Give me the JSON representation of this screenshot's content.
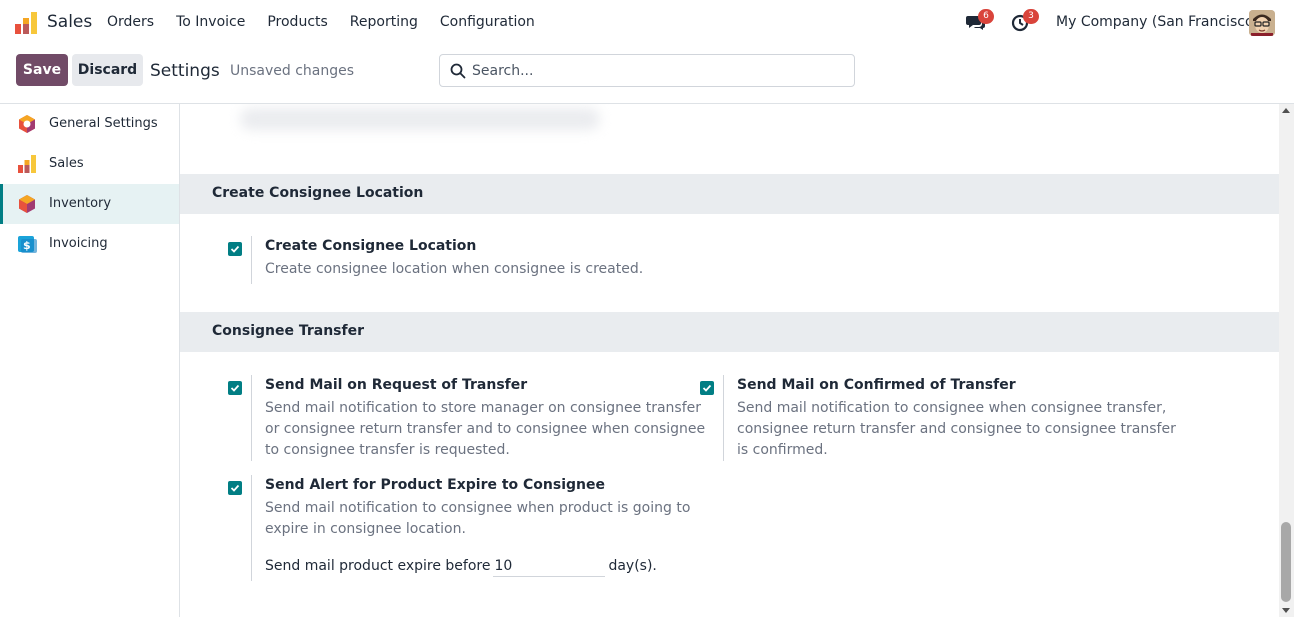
{
  "navbar": {
    "app_name": "Sales",
    "menu": [
      "Orders",
      "To Invoice",
      "Products",
      "Reporting",
      "Configuration"
    ],
    "messages_badge": "6",
    "activities_badge": "3",
    "company": "My Company (San Francisco)"
  },
  "control": {
    "save_label": "Save",
    "discard_label": "Discard",
    "breadcrumb": "Settings",
    "status": "Unsaved changes",
    "search_placeholder": "Search..."
  },
  "sidebar": {
    "items": [
      {
        "label": "General Settings",
        "icon": "general-settings-icon"
      },
      {
        "label": "Sales",
        "icon": "sales-app-icon"
      },
      {
        "label": "Inventory",
        "icon": "inventory-app-icon",
        "active": true
      },
      {
        "label": "Invoicing",
        "icon": "invoicing-app-icon"
      }
    ]
  },
  "sections": {
    "consignee_location": {
      "title": "Create Consignee Location",
      "setting": {
        "title": "Create Consignee Location",
        "desc": "Create consignee location when consignee is created.",
        "checked": true
      }
    },
    "consignee_transfer": {
      "title": "Consignee Transfer",
      "request_mail": {
        "title": "Send Mail on Request of Transfer",
        "desc_lines": [
          "Send mail notification to store manager on consignee transfer",
          "or consignee return transfer and to consignee when consignee",
          "to consignee transfer is requested."
        ],
        "checked": true
      },
      "confirmed_mail": {
        "title": "Send Mail on Confirmed of Transfer",
        "desc_lines": [
          "Send mail notification to consignee when consignee transfer,",
          "consignee return transfer and consignee to consignee transfer",
          "is confirmed."
        ],
        "checked": true
      },
      "expire_alert": {
        "title": "Send Alert for Product Expire to Consignee",
        "desc_lines": [
          "Send mail notification to consignee when product is going to",
          "expire in consignee location."
        ],
        "checked": true,
        "expire_prefix": "Send mail product expire before",
        "expire_value": "10",
        "expire_suffix": "day(s)."
      }
    }
  },
  "colors": {
    "primary": "#714b67",
    "accent": "#017e84",
    "badge": "#d9443b"
  }
}
